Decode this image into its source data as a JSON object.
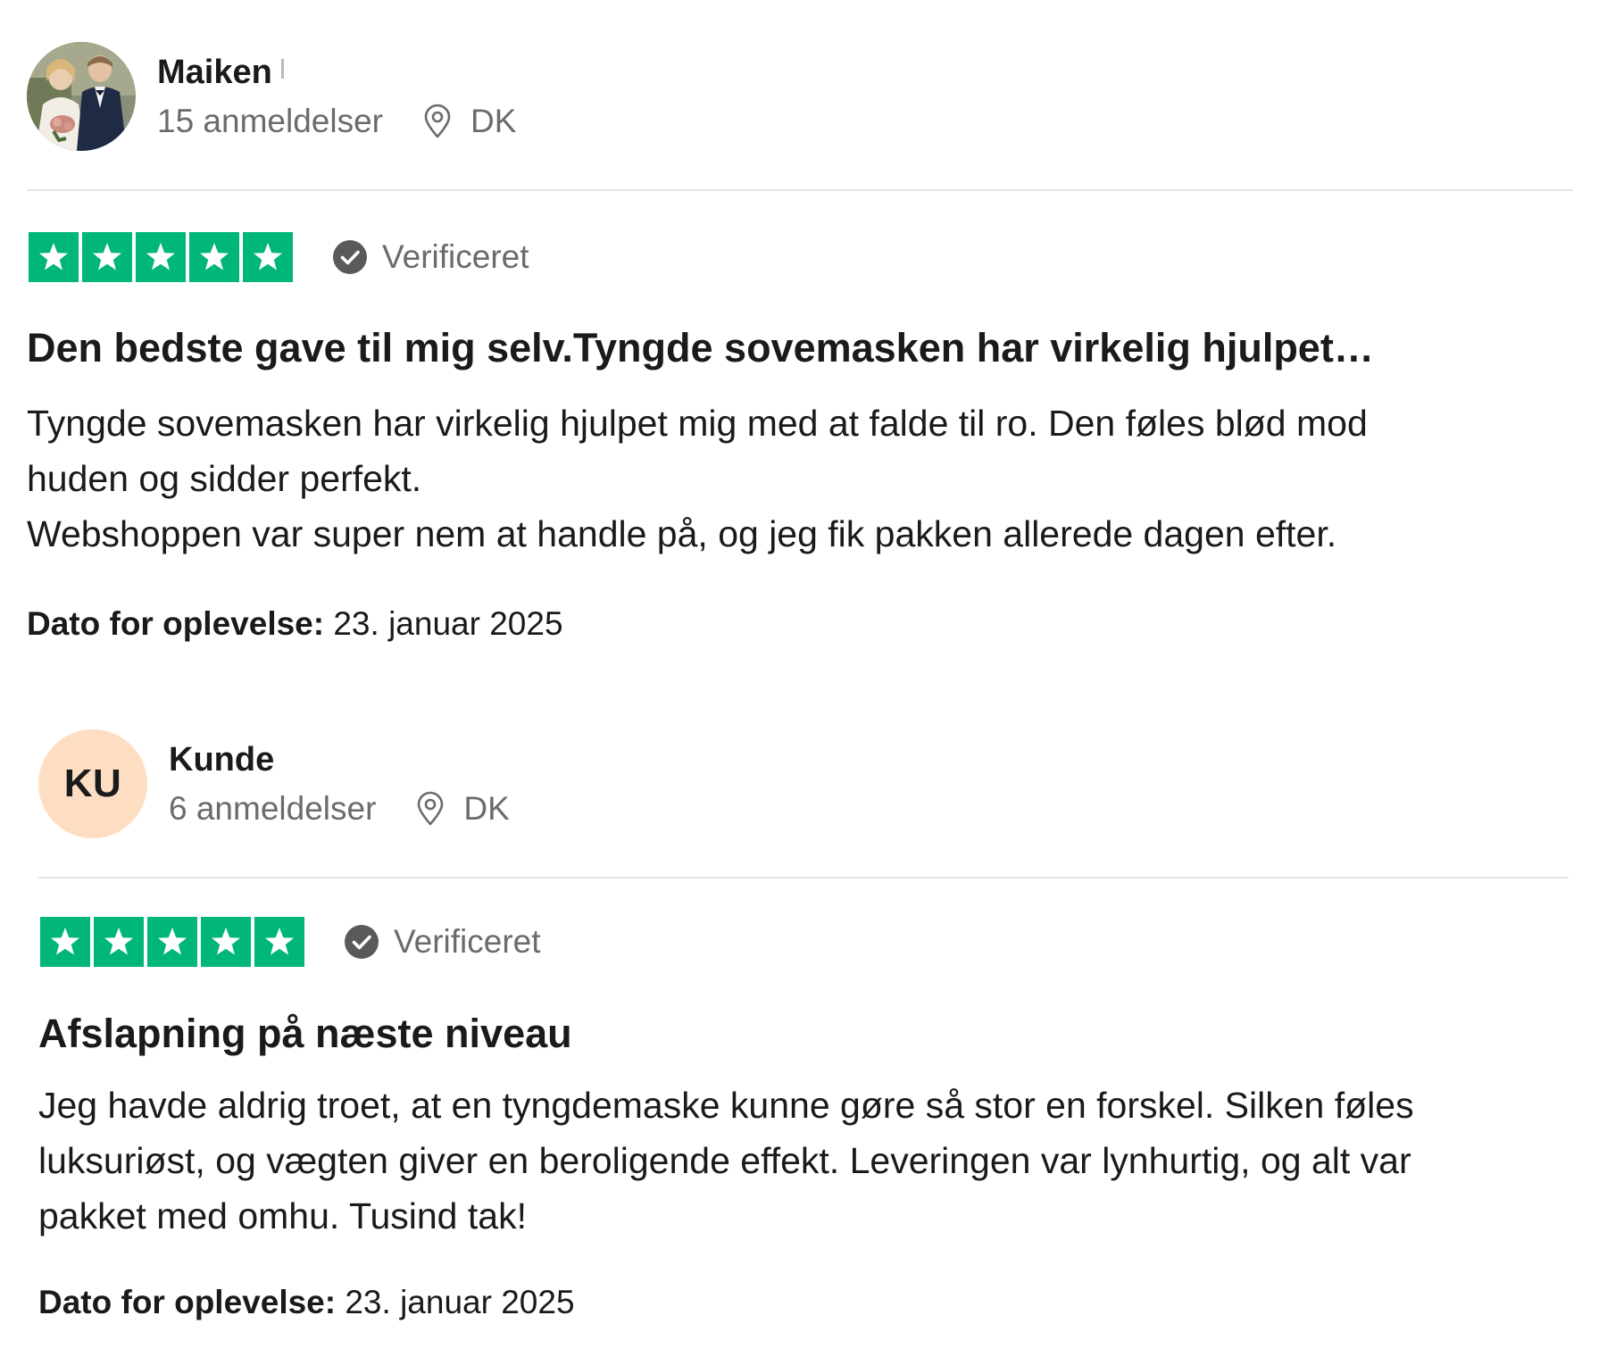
{
  "colors": {
    "star_green": "#00b67a",
    "muted_text": "#6b6b6b",
    "divider": "#e5e5dd",
    "initials_avatar_bg": "#fedec3"
  },
  "reviews": [
    {
      "reviewer": {
        "name": "Maiken",
        "avatar_type": "photo",
        "review_count": "15 anmeldelser",
        "country": "DK"
      },
      "rating": 5,
      "verified_label": "Verificeret",
      "title": "Den bedste gave til mig selv.Tyngde sovemasken har virkelig hjulpet…",
      "body_lines": [
        "Tyngde sovemasken har virkelig hjulpet mig med at falde til ro. Den føles blød mod",
        "huden og sidder perfekt.",
        "Webshoppen var super nem at handle på, og jeg fik pakken allerede dagen efter."
      ],
      "date_label": "Dato for oplevelse:",
      "date_value": "23. januar 2025"
    },
    {
      "reviewer": {
        "name": "Kunde",
        "avatar_type": "initials",
        "initials": "KU",
        "review_count": "6 anmeldelser",
        "country": "DK"
      },
      "rating": 5,
      "verified_label": "Verificeret",
      "title": "Afslapning på næste niveau",
      "body_lines": [
        "Jeg havde aldrig troet, at en tyngdemaske kunne gøre så stor en forskel. Silken føles",
        "luksuriøst, og vægten giver en beroligende effekt. Leveringen var lynhurtig, og alt var",
        "pakket med omhu. Tusind tak!"
      ],
      "date_label": "Dato for oplevelse:",
      "date_value": "23. januar 2025"
    }
  ],
  "icons": {
    "location": "map-pin-icon",
    "verified": "verified-check-icon",
    "star": "star-icon"
  }
}
